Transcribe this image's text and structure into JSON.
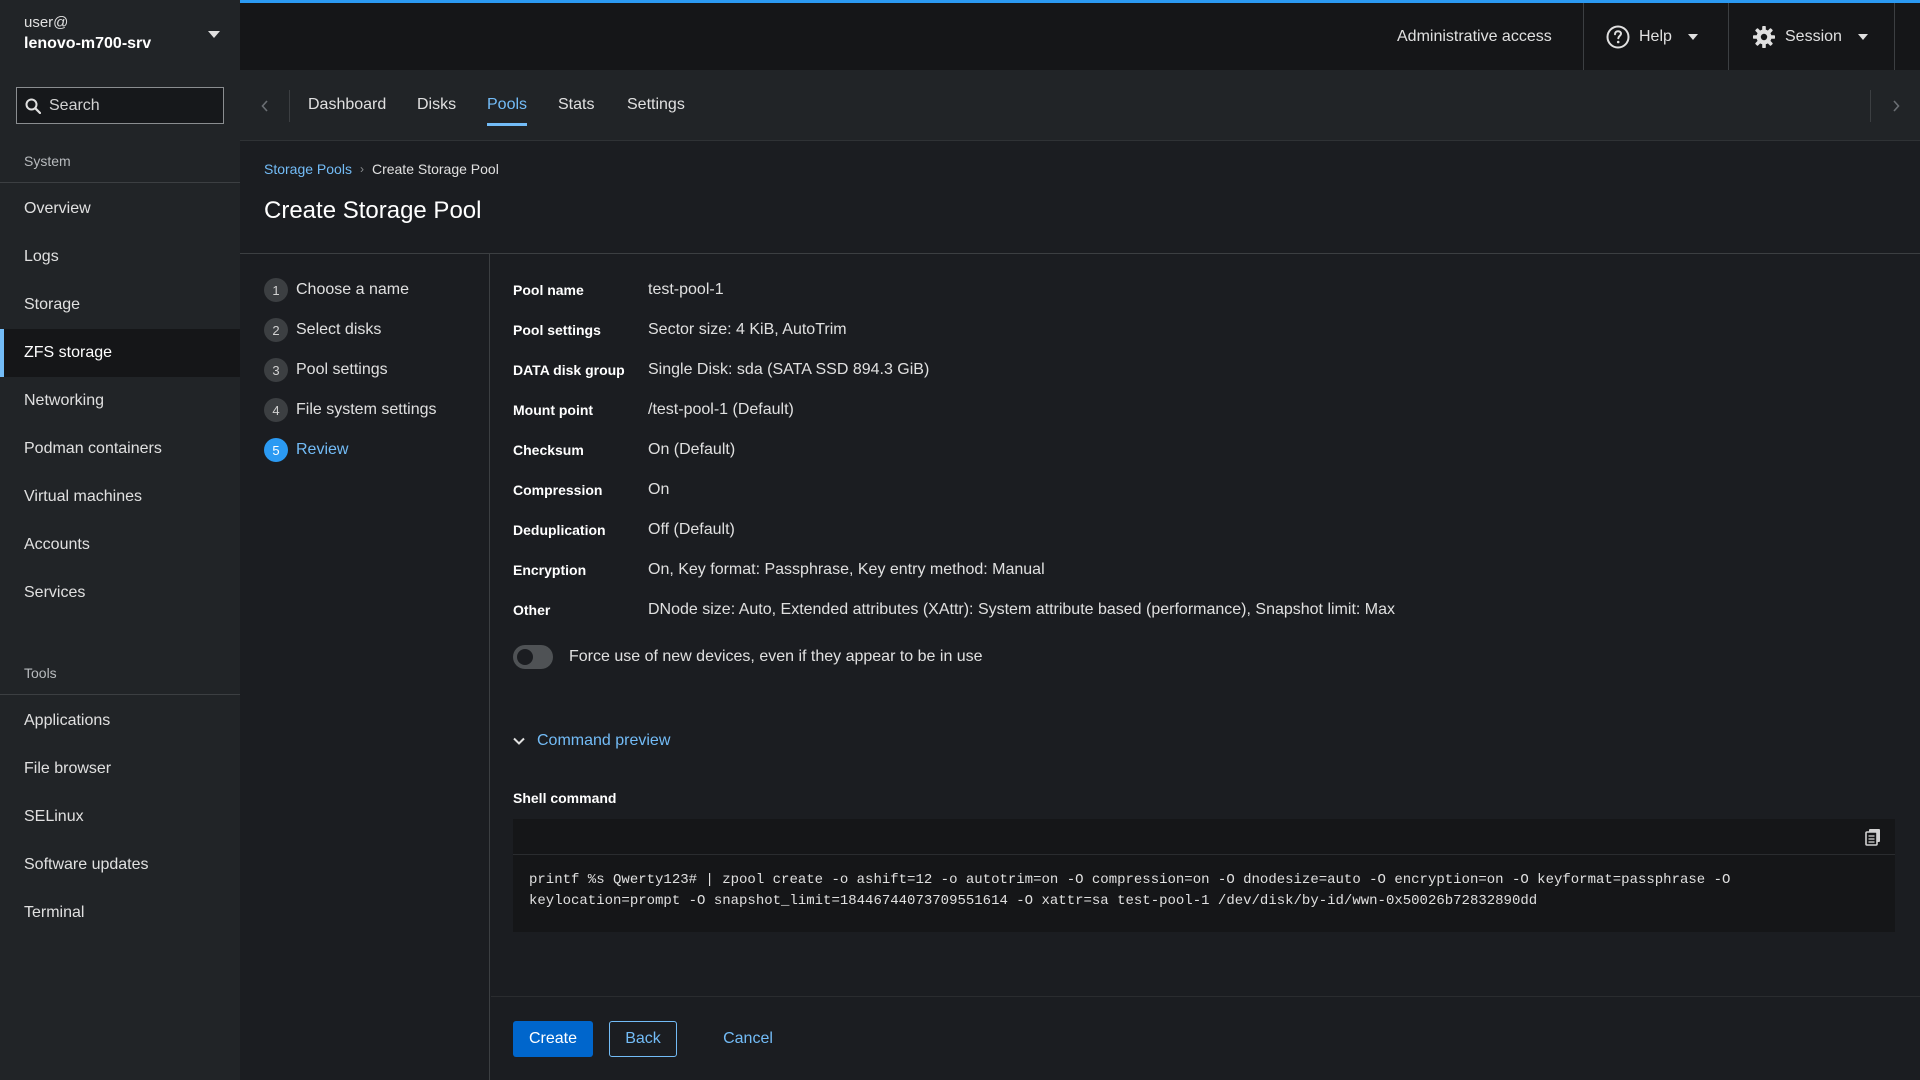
{
  "sidebar": {
    "host_user": "user@",
    "host_name": "lenovo-m700-srv",
    "search_placeholder": "Search",
    "system_label": "System",
    "system_items": [
      {
        "label": "Overview"
      },
      {
        "label": "Logs"
      },
      {
        "label": "Storage"
      },
      {
        "label": "ZFS storage",
        "active": true
      },
      {
        "label": "Networking"
      },
      {
        "label": "Podman containers"
      },
      {
        "label": "Virtual machines"
      },
      {
        "label": "Accounts"
      },
      {
        "label": "Services"
      }
    ],
    "tools_label": "Tools",
    "tools_items": [
      {
        "label": "Applications"
      },
      {
        "label": "File browser"
      },
      {
        "label": "SELinux"
      },
      {
        "label": "Software updates"
      },
      {
        "label": "Terminal"
      }
    ]
  },
  "masthead": {
    "admin_label": "Administrative access",
    "help_label": "Help",
    "session_label": "Session",
    "accent": "#2b9af3"
  },
  "tabs": [
    {
      "label": "Dashboard"
    },
    {
      "label": "Disks"
    },
    {
      "label": "Pools",
      "active": true
    },
    {
      "label": "Stats"
    },
    {
      "label": "Settings"
    }
  ],
  "breadcrumb": {
    "parent": "Storage Pools",
    "current": "Create Storage Pool"
  },
  "page_title": "Create Storage Pool",
  "wizard": {
    "steps": [
      {
        "num": "1",
        "label": "Choose a name"
      },
      {
        "num": "2",
        "label": "Select disks"
      },
      {
        "num": "3",
        "label": "Pool settings"
      },
      {
        "num": "4",
        "label": "File system settings"
      },
      {
        "num": "5",
        "label": "Review",
        "current": true
      }
    ],
    "review": [
      {
        "key": "Pool name",
        "value": "test-pool-1"
      },
      {
        "key": "Pool settings",
        "value": "Sector size: 4 KiB, AutoTrim"
      },
      {
        "key": "DATA disk group",
        "value": "Single Disk: sda (SATA SSD 894.3 GiB)"
      },
      {
        "key": "Mount point",
        "value": "/test-pool-1 (Default)"
      },
      {
        "key": "Checksum",
        "value": "On (Default)"
      },
      {
        "key": "Compression",
        "value": "On"
      },
      {
        "key": "Deduplication",
        "value": "Off (Default)"
      },
      {
        "key": "Encryption",
        "value": "On, Key format: Passphrase, Key entry method: Manual"
      },
      {
        "key": "Other",
        "value": "DNode size: Auto, Extended attributes (XAttr): System attribute based (performance), Snapshot limit: Max"
      }
    ],
    "force_toggle_label": "Force use of new devices, even if they appear to be in use",
    "force_toggle_on": false,
    "command_preview_label": "Command preview",
    "shell_command_label": "Shell command",
    "shell_command_line1": "printf %s Qwerty123# | zpool create -o ashift=12 -o autotrim=on -O compression=on -O dnodesize=auto -O encryption=on -O keyformat=passphrase -O",
    "shell_command_line2": "keylocation=prompt -O snapshot_limit=18446744073709551614 -O xattr=sa test-pool-1 /dev/disk/by-id/wwn-0x50026b72832890dd"
  },
  "footer": {
    "create_label": "Create",
    "back_label": "Back",
    "cancel_label": "Cancel"
  }
}
